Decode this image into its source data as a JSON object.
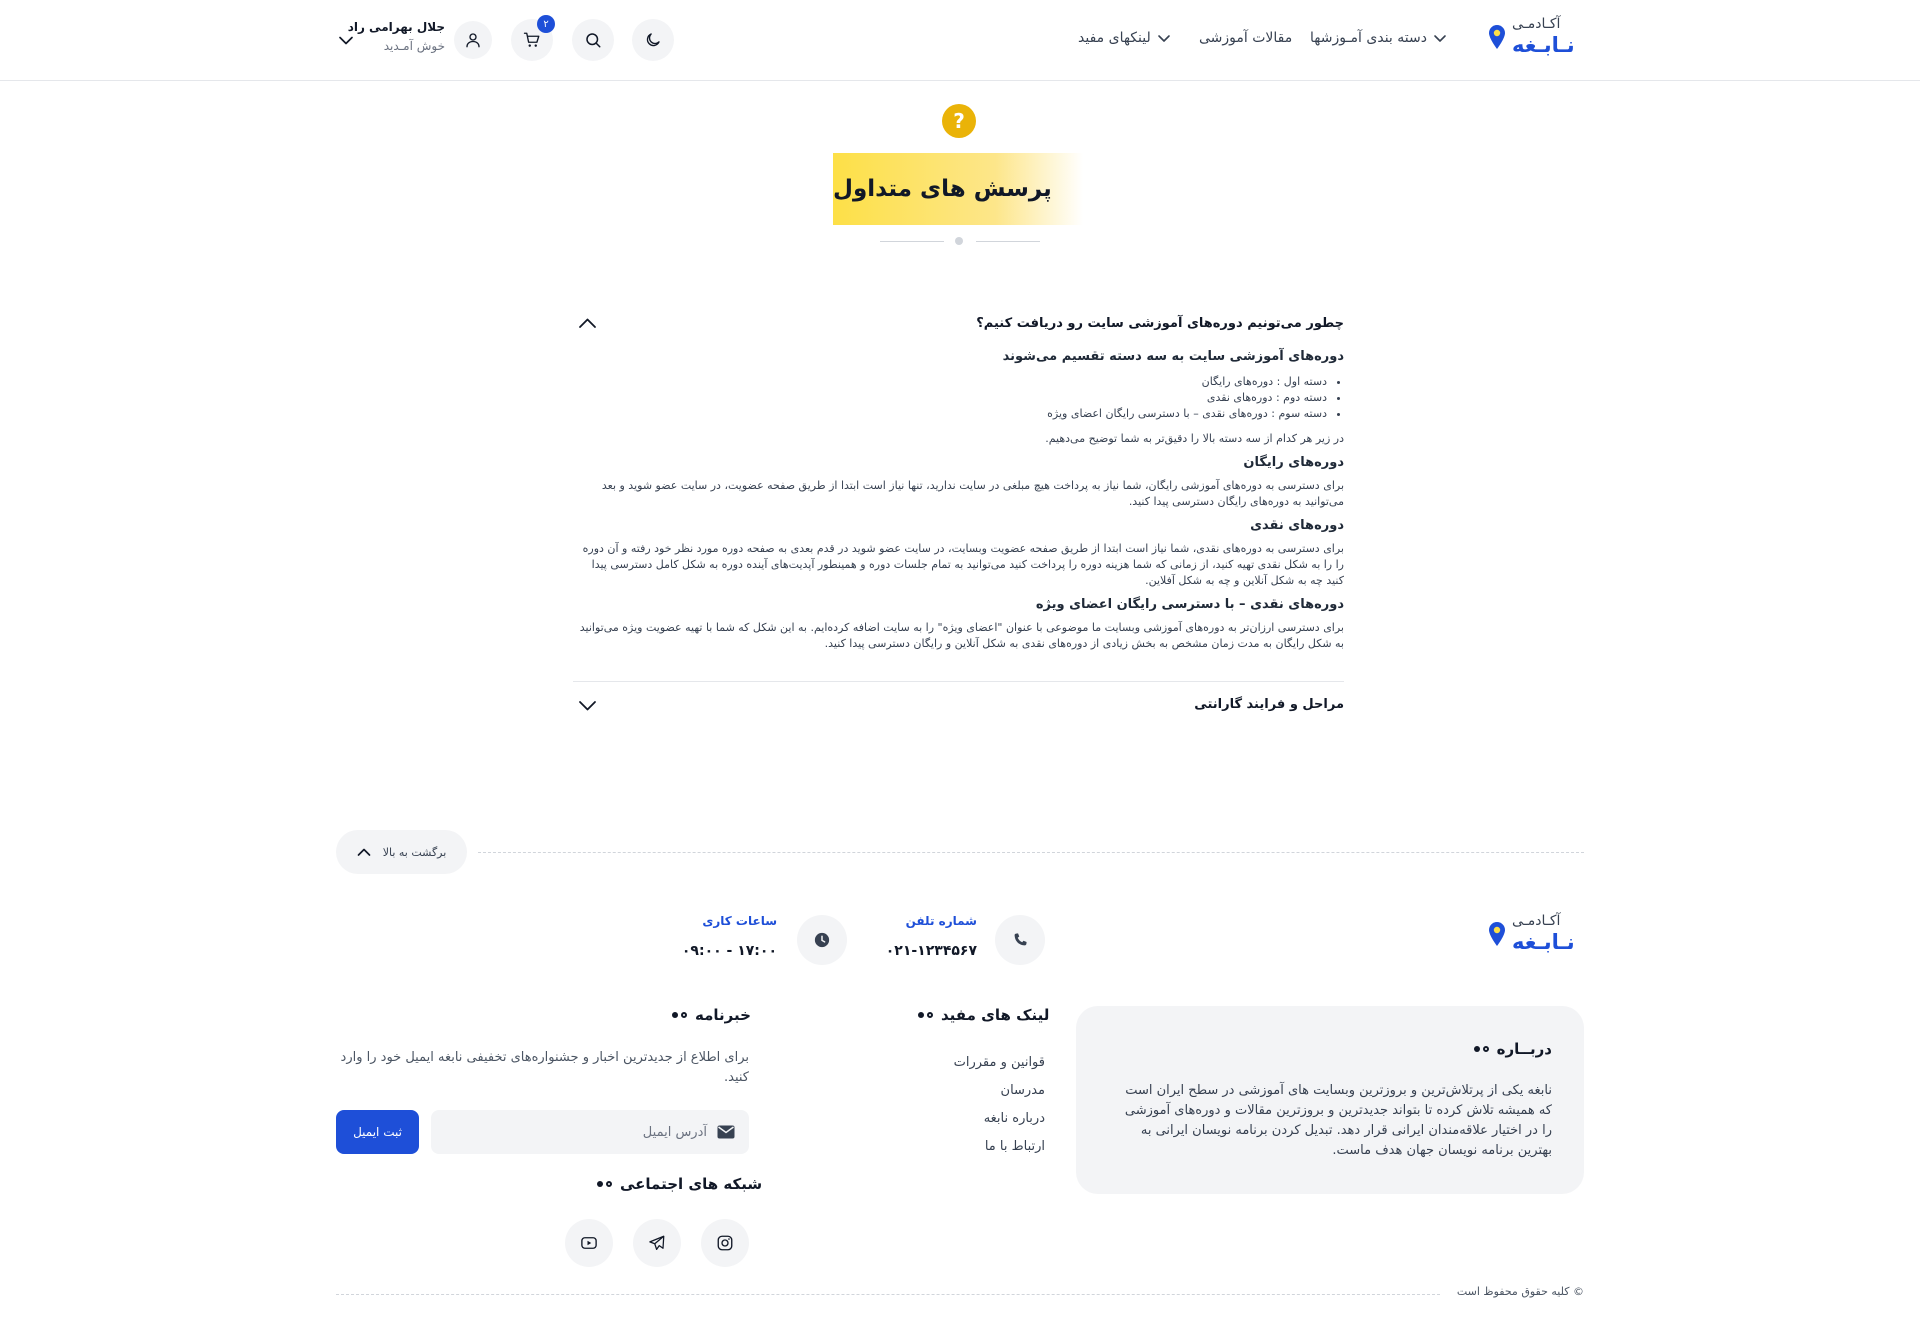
{
  "header": {
    "logo": {
      "line1": "آکـادمـی",
      "line2": "نـابـغه"
    },
    "nav": [
      {
        "label": "دسته بندی آمـوزشها",
        "has_dropdown": true
      },
      {
        "label": "مقالات آموزشی",
        "has_dropdown": false
      },
      {
        "label": "لینکهای مفید",
        "has_dropdown": true
      }
    ],
    "cart_count": "۲",
    "user": {
      "name": "جلال بهرامی راد",
      "greeting": "خوش آمـدید"
    },
    "icons": [
      "moon-icon",
      "search-icon",
      "cart-icon",
      "user-icon",
      "chevron-down-icon"
    ]
  },
  "faq_section": {
    "title": "پرسش های متداول",
    "items": [
      {
        "question": "چطور می‌تونیم دوره‌های آموزشی سایت رو دریافت کنیم؟",
        "expanded": true,
        "answer": {
          "intro_heading": "دوره‌های آموزشی سایت به سه دسته تقسیم می‌شوند",
          "list": [
            "دسته اول : دوره‌های رایگان",
            "دسته دوم : دوره‌های نقدی",
            "دسته سوم : دوره‌های نقدی – با دسترسی رایگان اعضای ویژه"
          ],
          "intro_text": "در زیر هر کدام از سه دسته بالا را دقیق‌تر به شما توضیح می‌دهیم.",
          "sections": [
            {
              "heading": "دوره‌های رایگان",
              "text": "برای دسترسی به دوره‌های آموزشی رایگان، شما نیاز به پرداخت هیچ مبلغی در سایت ندارید، تنها نیاز است ابتدا از طریق صفحه عضویت، در سایت عضو شوید و بعد می‌توانید به دوره‌های رایگان دسترسی پیدا کنید."
            },
            {
              "heading": "دوره‌های نقدی",
              "text": "برای دسترسی به دوره‌های نقدی، شما نیاز است ابتدا از طریق صفحه عضویت وبسایت، در سایت عضو شوید در قدم بعدی به صفحه دوره مورد نظر خود رفته و آن دوره را را به شکل نقدی تهیه کنید، از زمانی که شما هزینه دوره را پرداخت کنید می‌توانید به تمام جلسات دوره و همینطور آپدیت‌های آینده دوره به شکل کامل دسترسی پیدا کنید چه به شکل آنلاین و چه به شکل آفلاین."
            },
            {
              "heading": "دوره‌های نقدی – با دسترسی رایگان اعضای ویژه",
              "text": "برای دسترسی ارزان‌تر به دوره‌های آموزشی وبسایت ما موضوعی با عنوان \"اعضای ویژه\" را به سایت اضافه کرده‌ایم. به این شکل که شما با تهیه عضویت ویژه می‌توانید به شکل رایگان به مدت زمان مشخص به بخش زیادی از دوره‌های نقدی به شکل آنلاین و رایگان دسترسی پیدا کنید."
            }
          ]
        }
      },
      {
        "question": "مراحل و فرایند گارانتی",
        "expanded": false
      }
    ]
  },
  "back_to_top": "برگشت به بالا",
  "footer": {
    "phone": {
      "label": "شماره تلفن",
      "value": "۰۲۱-۱۲۳۴۵۶۷"
    },
    "hours": {
      "label": "ساعات کاری",
      "value": "۰۹:۰۰ - ۱۷:۰۰"
    },
    "about": {
      "title": "دربــاره",
      "text": "نابغه یکی از پرتلاش‌ترین و بروزترین وبسایت های آموزشی در سطح ایران است که همیشه تلاش کرده تا بتواند جدیدترین و بروزترین مقالات و دوره‌های آموزشی را در اختیار علاقه‌مندان ایرانی قرار دهد. تبدیل کردن برنامه نویسان ایرانی به بهترین برنامه نویسان جهان هدف ماست."
    },
    "useful_links": {
      "title": "لینک های مفید",
      "items": [
        "قوانین و مقررات",
        "مدرسان",
        "درباره نابغه",
        "ارتباط با ما"
      ]
    },
    "newsletter": {
      "title": "خبرنامه",
      "text": "برای اطلاع از جدیدترین اخبار و جشنواره‌های تخفیفی نابغه ایمیل خود را وارد کنید.",
      "placeholder": "آدرس ایمیل",
      "button": "ثبت ایمیل"
    },
    "social": {
      "title": "شبکه های اجتماعی",
      "icons": [
        "instagram-icon",
        "telegram-icon",
        "youtube-icon"
      ]
    },
    "copyright": "© کلیه حقوق محفوظ است"
  },
  "colors": {
    "accent": "#1e4fd8",
    "highlight": "#fde047",
    "question_mark": "#eab308"
  }
}
